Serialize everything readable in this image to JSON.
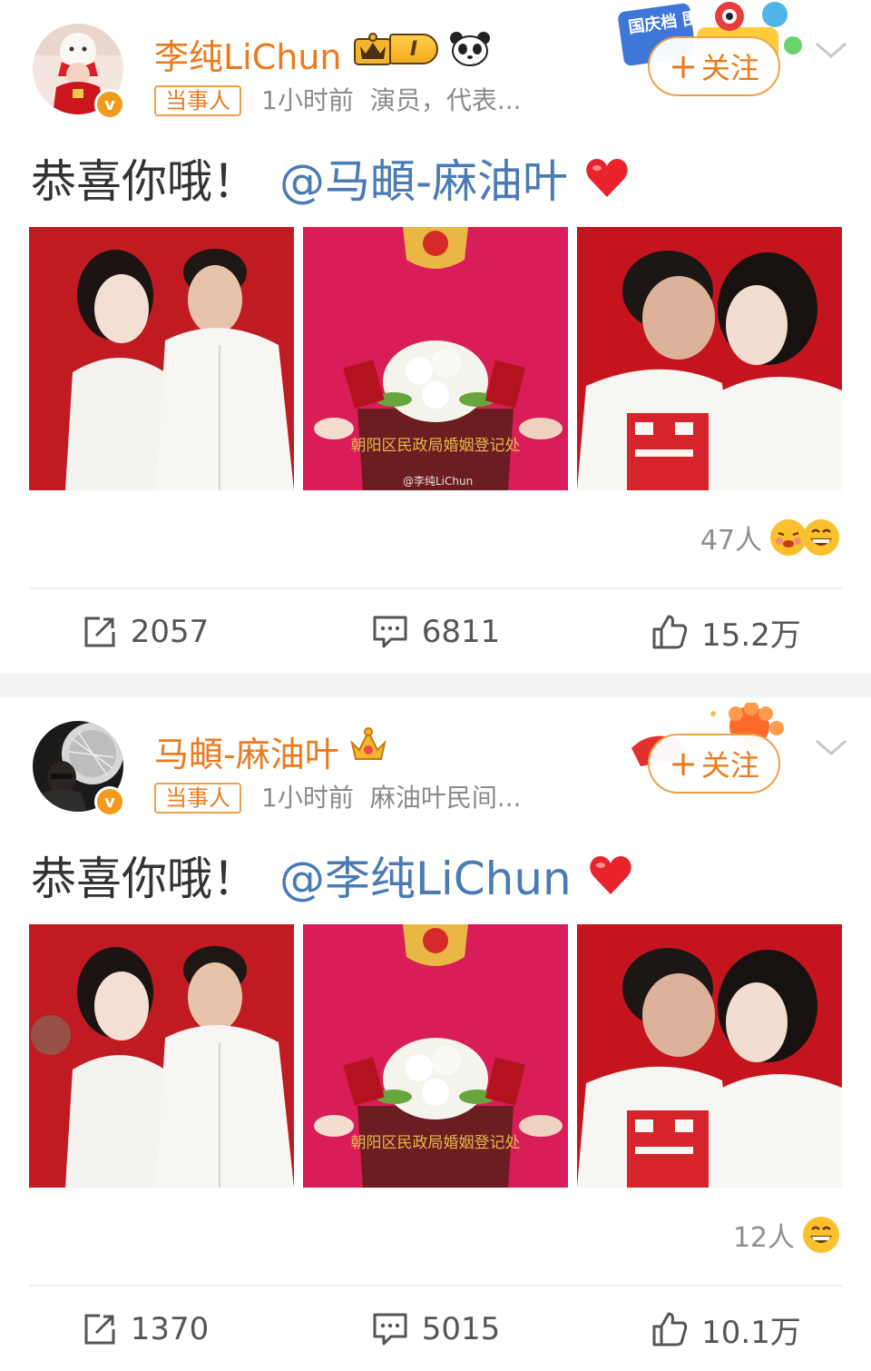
{
  "colors": {
    "accent": "#eb7a1e",
    "mention": "#4a7bb5",
    "heart": "#e8232c",
    "photo_red": "#c01b22",
    "photo_pink": "#d81d58"
  },
  "posts": [
    {
      "username": "李纯LiChun",
      "level": "I",
      "tag": "当事人",
      "time": "1小时前",
      "source": "演员，代表...",
      "promo_text": "国庆档 围观",
      "follow_label": "关注",
      "text": "恭喜你哦！",
      "mention": "@马頔-麻油叶",
      "photo_caption": "朝阳区民政局婚姻登记处",
      "photo_watermark": "@李纯LiChun",
      "reaction_count": "47人",
      "share_count": "2057",
      "comment_count": "6811",
      "like_count": "15.2万",
      "icons": [
        "crown-icon",
        "panda-icon",
        "heart-icon",
        "share-icon",
        "comment-icon",
        "like-icon"
      ]
    },
    {
      "username": "马頔-麻油叶",
      "tag": "当事人",
      "time": "1小时前",
      "source": "麻油叶民间...",
      "follow_label": "关注",
      "text": "恭喜你哦！",
      "mention": "@李纯LiChun",
      "photo_caption": "朝阳区民政局婚姻登记处",
      "reaction_count": "12人",
      "share_count": "1370",
      "comment_count": "5015",
      "like_count": "10.1万",
      "icons": [
        "crown-icon",
        "heart-icon",
        "share-icon",
        "comment-icon",
        "like-icon"
      ]
    }
  ]
}
